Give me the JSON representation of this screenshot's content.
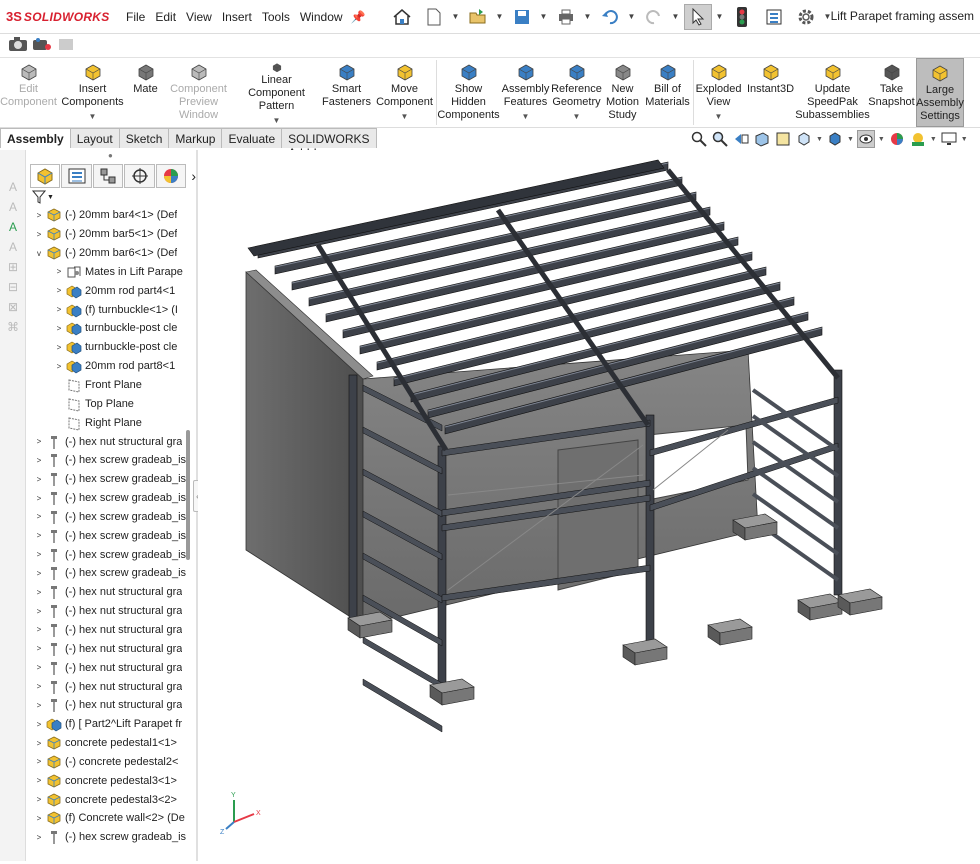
{
  "app": {
    "brand_prefix": "3S",
    "brand": "SOLIDWORKS",
    "document_title": "Lift Parapet framing assem"
  },
  "menu": [
    "File",
    "Edit",
    "View",
    "Insert",
    "Tools",
    "Window"
  ],
  "quick_access_icons": [
    "home-icon",
    "new-document-icon",
    "open-icon",
    "save-icon",
    "print-icon",
    "undo-icon",
    "redo-icon",
    "select-arrow-icon",
    "rebuild-traffic-light-icon",
    "file-properties-icon",
    "options-gear-icon"
  ],
  "ribbon": [
    {
      "label": "Edit\nComponent",
      "enabled": false,
      "dropdown": false
    },
    {
      "label": "Insert\nComponents",
      "enabled": true,
      "dropdown": true
    },
    {
      "label": "Mate",
      "enabled": true,
      "dropdown": false
    },
    {
      "label": "Component\nPreview\nWindow",
      "enabled": false,
      "dropdown": false
    },
    {
      "label": "Linear Component\nPattern",
      "enabled": true,
      "dropdown": true
    },
    {
      "label": "Smart\nFasteners",
      "enabled": true,
      "dropdown": false
    },
    {
      "label": "Move\nComponent",
      "enabled": true,
      "dropdown": true
    },
    {
      "label": "Show\nHidden\nComponents",
      "enabled": true,
      "dropdown": false
    },
    {
      "label": "Assembly\nFeatures",
      "enabled": true,
      "dropdown": true
    },
    {
      "label": "Reference\nGeometry",
      "enabled": true,
      "dropdown": true
    },
    {
      "label": "New\nMotion\nStudy",
      "enabled": true,
      "dropdown": false
    },
    {
      "label": "Bill of\nMaterials",
      "enabled": true,
      "dropdown": false
    },
    {
      "label": "Exploded\nView",
      "enabled": true,
      "dropdown": true
    },
    {
      "label": "Instant3D",
      "enabled": true,
      "dropdown": false
    },
    {
      "label": "Update\nSpeedPak\nSubassemblies",
      "enabled": true,
      "dropdown": false
    },
    {
      "label": "Take\nSnapshot",
      "enabled": true,
      "dropdown": false
    },
    {
      "label": "Large\nAssembly\nSettings",
      "enabled": true,
      "dropdown": false,
      "active": true
    }
  ],
  "tabs": [
    {
      "label": "Assembly",
      "active": true
    },
    {
      "label": "Layout"
    },
    {
      "label": "Sketch"
    },
    {
      "label": "Markup"
    },
    {
      "label": "Evaluate"
    },
    {
      "label": "SOLIDWORKS Add-Ins"
    }
  ],
  "tree": {
    "panel_tabs": [
      "featuremanager-tree-icon",
      "propertymanager-icon",
      "configurationmanager-icon",
      "dimxpert-icon",
      "display-manager-icon"
    ],
    "items": [
      {
        "level": 0,
        "expander": ">",
        "icon": "part",
        "label": "(-) 20mm bar4<1> (Def"
      },
      {
        "level": 0,
        "expander": ">",
        "icon": "part",
        "label": "(-) 20mm bar5<1> (Def"
      },
      {
        "level": 0,
        "expander": "v",
        "icon": "part",
        "label": "(-) 20mm bar6<1> (Def"
      },
      {
        "level": 1,
        "expander": ">",
        "icon": "mates",
        "label": "Mates in Lift Parape"
      },
      {
        "level": 1,
        "expander": ">",
        "icon": "subasm",
        "label": "20mm rod part4<1"
      },
      {
        "level": 1,
        "expander": ">",
        "icon": "subasm",
        "label": "(f) turnbuckle<1> (I"
      },
      {
        "level": 1,
        "expander": ">",
        "icon": "subasm",
        "label": "turnbuckle-post cle"
      },
      {
        "level": 1,
        "expander": ">",
        "icon": "subasm",
        "label": "turnbuckle-post cle"
      },
      {
        "level": 1,
        "expander": ">",
        "icon": "subasm",
        "label": "20mm rod part8<1"
      },
      {
        "level": 1,
        "expander": "",
        "icon": "plane",
        "label": "Front Plane"
      },
      {
        "level": 1,
        "expander": "",
        "icon": "plane",
        "label": "Top Plane"
      },
      {
        "level": 1,
        "expander": "",
        "icon": "plane",
        "label": "Right Plane"
      },
      {
        "level": 0,
        "expander": ">",
        "icon": "fastener",
        "label": "(-) hex nut structural gra"
      },
      {
        "level": 0,
        "expander": ">",
        "icon": "fastener",
        "label": "(-) hex screw gradeab_is"
      },
      {
        "level": 0,
        "expander": ">",
        "icon": "fastener",
        "label": "(-) hex screw gradeab_is"
      },
      {
        "level": 0,
        "expander": ">",
        "icon": "fastener",
        "label": "(-) hex screw gradeab_is"
      },
      {
        "level": 0,
        "expander": ">",
        "icon": "fastener",
        "label": "(-) hex screw gradeab_is"
      },
      {
        "level": 0,
        "expander": ">",
        "icon": "fastener",
        "label": "(-) hex screw gradeab_is"
      },
      {
        "level": 0,
        "expander": ">",
        "icon": "fastener",
        "label": "(-) hex screw gradeab_is"
      },
      {
        "level": 0,
        "expander": ">",
        "icon": "fastener",
        "label": "(-) hex screw gradeab_is"
      },
      {
        "level": 0,
        "expander": ">",
        "icon": "fastener",
        "label": "(-) hex nut structural gra"
      },
      {
        "level": 0,
        "expander": ">",
        "icon": "fastener",
        "label": "(-) hex nut structural gra"
      },
      {
        "level": 0,
        "expander": ">",
        "icon": "fastener",
        "label": "(-) hex nut structural gra"
      },
      {
        "level": 0,
        "expander": ">",
        "icon": "fastener",
        "label": "(-) hex nut structural gra"
      },
      {
        "level": 0,
        "expander": ">",
        "icon": "fastener",
        "label": "(-) hex nut structural gra"
      },
      {
        "level": 0,
        "expander": ">",
        "icon": "fastener",
        "label": "(-) hex nut structural gra"
      },
      {
        "level": 0,
        "expander": ">",
        "icon": "fastener",
        "label": "(-) hex nut structural gra"
      },
      {
        "level": 0,
        "expander": ">",
        "icon": "subasm",
        "label": "(f) [ Part2^Lift Parapet fr"
      },
      {
        "level": 0,
        "expander": ">",
        "icon": "part",
        "label": "concrete pedestal1<1>"
      },
      {
        "level": 0,
        "expander": ">",
        "icon": "part",
        "label": "(-) concrete pedestal2<"
      },
      {
        "level": 0,
        "expander": ">",
        "icon": "part",
        "label": "concrete pedestal3<1>"
      },
      {
        "level": 0,
        "expander": ">",
        "icon": "part",
        "label": "concrete pedestal3<2>"
      },
      {
        "level": 0,
        "expander": ">",
        "icon": "part",
        "label": "(f) Concrete wall<2> (De"
      },
      {
        "level": 0,
        "expander": ">",
        "icon": "fastener",
        "label": "(-) hex screw gradeab_is"
      }
    ]
  },
  "triad": {
    "x": "X",
    "y": "Y",
    "z": "Z"
  },
  "colors": {
    "accent": "#d8202f",
    "steel": "#3d4149",
    "wall": "#5e5e5e",
    "part_yellow": "#f2c230",
    "part_blue": "#3a7fc4"
  }
}
